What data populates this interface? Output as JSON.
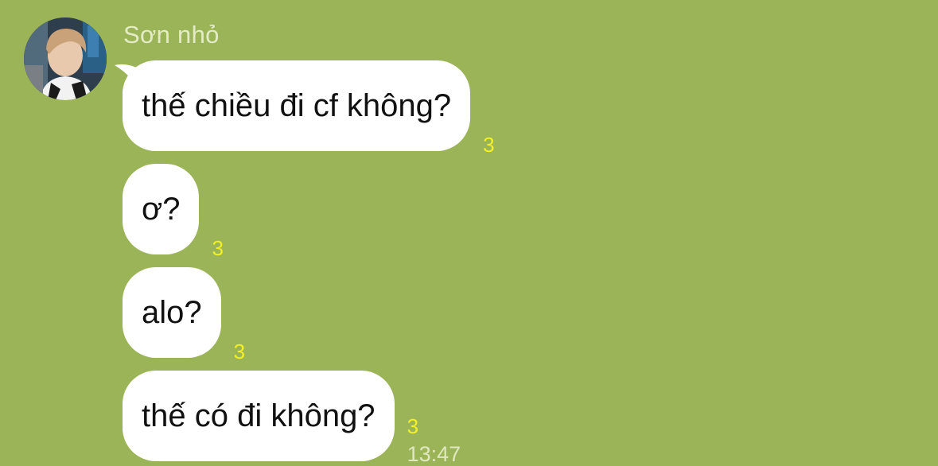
{
  "sender": {
    "name": "Sơn nhỏ"
  },
  "messages": [
    {
      "text": "thế chiều đi cf không?",
      "read_count": "3"
    },
    {
      "text": "ơ?",
      "read_count": "3"
    },
    {
      "text": "alo?",
      "read_count": "3"
    },
    {
      "text": "thế có đi không?",
      "read_count": "3",
      "time": "13:47"
    }
  ],
  "colors": {
    "chat_background": "#9bb458",
    "bubble": "#ffffff",
    "read_count": "#f3f027",
    "muted_text": "#e3ebc7"
  }
}
